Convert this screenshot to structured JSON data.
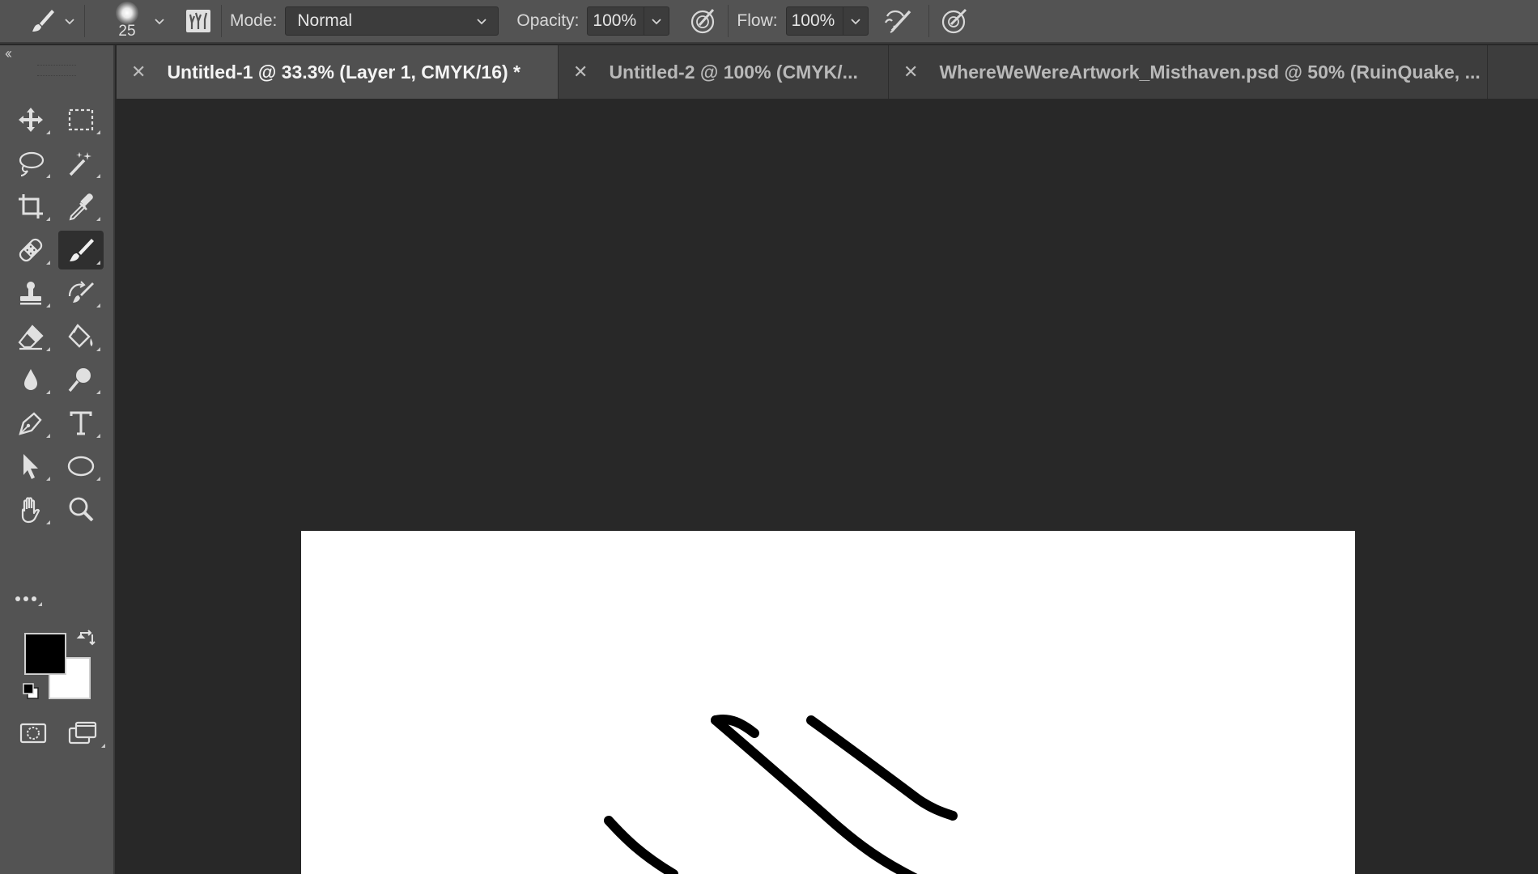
{
  "options_bar": {
    "brush_size": "25",
    "mode_label": "Mode:",
    "mode_value": "Normal",
    "opacity_label": "Opacity:",
    "opacity_value": "100%",
    "flow_label": "Flow:",
    "flow_value": "100%",
    "icons": [
      "brush-icon",
      "chevron-down-icon",
      "brush-settings-panel-icon",
      "pressure-opacity-icon",
      "airbrush-icon",
      "pressure-size-icon"
    ]
  },
  "tool_panel": {
    "collapse_glyph": "‹‹",
    "tools": [
      {
        "name": "move-tool",
        "icon": "move-icon"
      },
      {
        "name": "marquee-tool",
        "icon": "rect-marquee-icon"
      },
      {
        "name": "lasso-tool",
        "icon": "lasso-icon"
      },
      {
        "name": "magic-wand-tool",
        "icon": "magic-wand-icon"
      },
      {
        "name": "crop-tool",
        "icon": "crop-icon"
      },
      {
        "name": "eyedropper-tool",
        "icon": "eyedropper-icon"
      },
      {
        "name": "healing-brush-tool",
        "icon": "bandage-icon"
      },
      {
        "name": "brush-tool",
        "icon": "brush-icon",
        "active": true
      },
      {
        "name": "clone-stamp-tool",
        "icon": "stamp-icon"
      },
      {
        "name": "history-brush-tool",
        "icon": "history-brush-icon"
      },
      {
        "name": "eraser-tool",
        "icon": "eraser-icon"
      },
      {
        "name": "paint-bucket-tool",
        "icon": "paint-bucket-icon"
      },
      {
        "name": "blur-tool",
        "icon": "blur-drop-icon"
      },
      {
        "name": "dodge-tool",
        "icon": "dodge-icon"
      },
      {
        "name": "pen-tool",
        "icon": "pen-icon"
      },
      {
        "name": "type-tool",
        "icon": "type-icon"
      },
      {
        "name": "path-selection-tool",
        "icon": "arrow-icon"
      },
      {
        "name": "ellipse-tool",
        "icon": "ellipse-icon"
      },
      {
        "name": "hand-tool",
        "icon": "hand-icon"
      },
      {
        "name": "zoom-tool",
        "icon": "zoom-icon"
      }
    ],
    "foreground_color": "#000000",
    "background_color": "#ffffff"
  },
  "tabs": [
    {
      "label": "Untitled-1 @ 33.3% (Layer 1, CMYK/16) *",
      "active": true
    },
    {
      "label": "Untitled-2 @ 100% (CMYK/...",
      "active": false
    },
    {
      "label": "WhereWeWereArtwork_Misthaven.psd @ 50% (RuinQuake, ...",
      "active": false
    }
  ],
  "colors": {
    "panel": "#535353",
    "workspace": "#282828",
    "tab_active": "#505050",
    "tab_inactive": "#3d3d3d",
    "canvas": "#ffffff",
    "stroke": "#000000"
  }
}
